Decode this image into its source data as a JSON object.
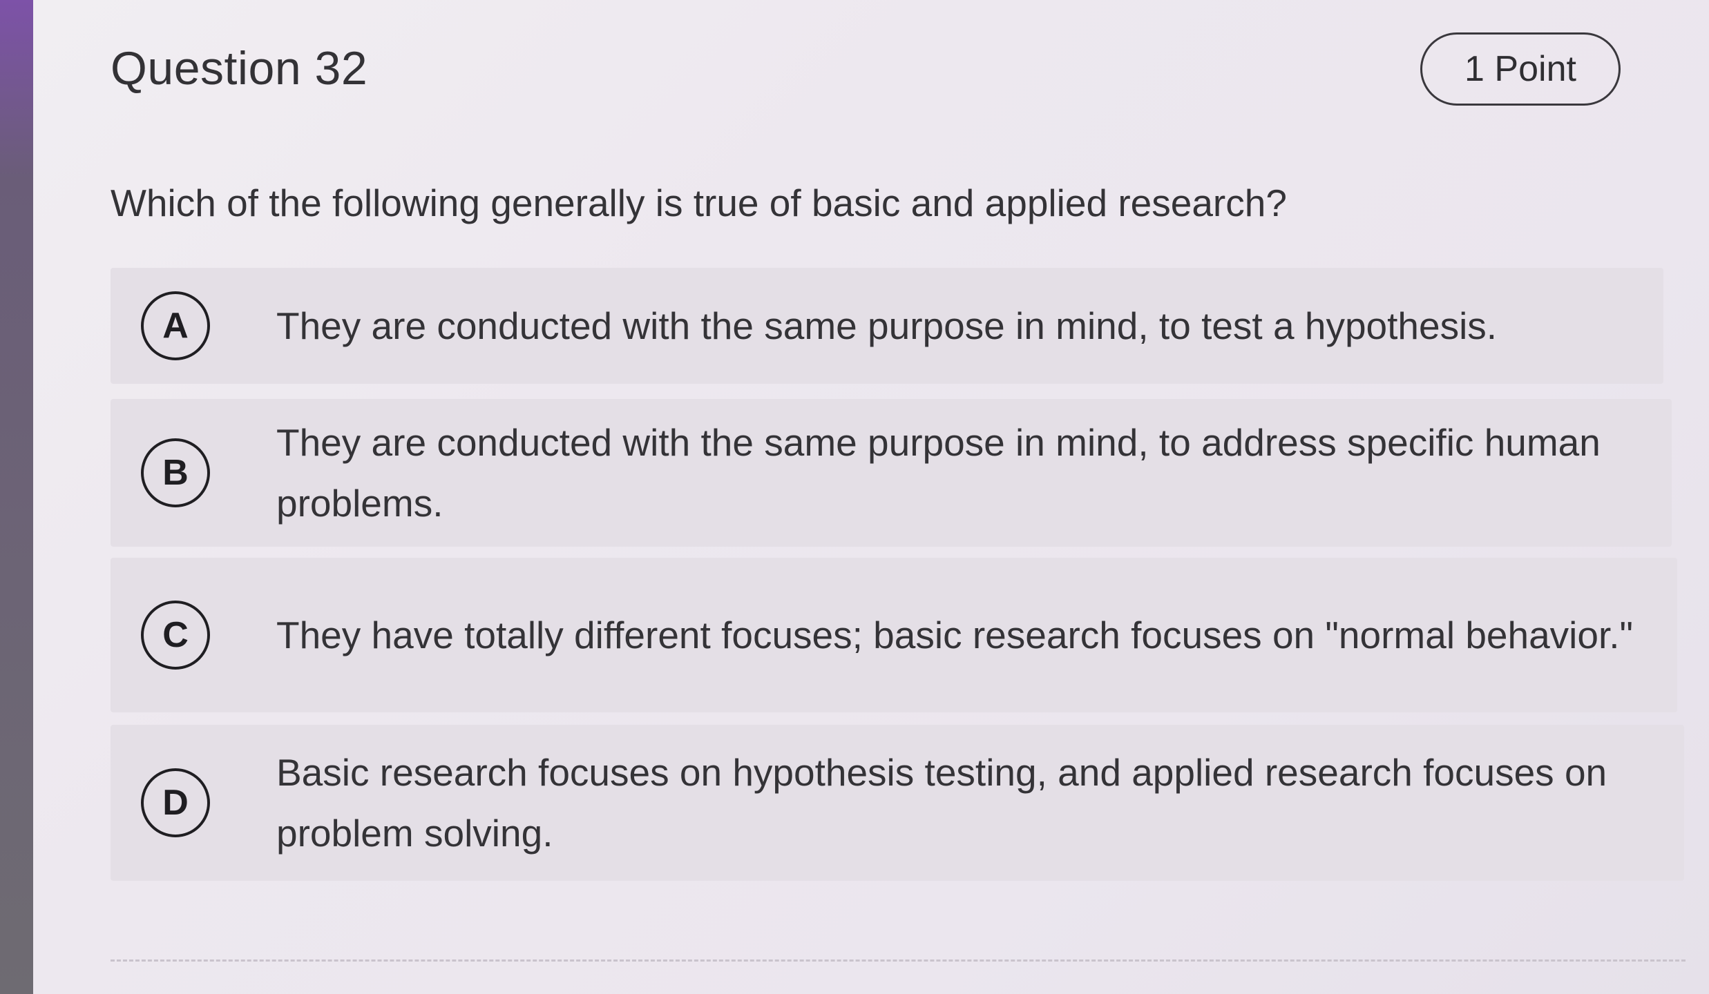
{
  "question": {
    "title": "Question 32",
    "points": "1 Point",
    "text": "Which of the following generally is true of basic and applied research?"
  },
  "choices": [
    {
      "letter": "A",
      "text": "They are conducted with the same purpose in mind, to test a hypothesis."
    },
    {
      "letter": "B",
      "text": "They are conducted with the same purpose in mind, to address specific human problems."
    },
    {
      "letter": "C",
      "text": "They have totally different focuses; basic research focuses on \"normal behavior.\""
    },
    {
      "letter": "D",
      "text": "Basic research focuses on hypothesis testing, and applied research focuses on problem solving."
    }
  ],
  "colors": {
    "text": "#343337",
    "choice_background": "#e4dfe6",
    "page_background": "#ece7ee"
  }
}
